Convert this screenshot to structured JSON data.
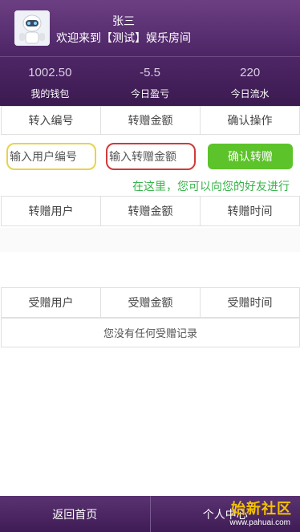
{
  "header": {
    "user_name": "张三",
    "welcome": "欢迎来到【测试】娱乐房间"
  },
  "stats": [
    {
      "value": "1002.50",
      "label": "我的钱包"
    },
    {
      "value": "-5.5",
      "label": "今日盈亏"
    },
    {
      "value": "220",
      "label": "今日流水"
    }
  ],
  "transfer": {
    "col1": "转入编号",
    "col2": "转赠金额",
    "col3": "确认操作",
    "user_placeholder": "输入用户编号",
    "amount_placeholder": "输入转赠金额",
    "confirm_label": "确认转赠"
  },
  "notice": "在这里，您可以向您的好友进行",
  "sent_table": {
    "col1": "转赠用户",
    "col2": "转赠金额",
    "col3": "转赠时间"
  },
  "received_table": {
    "col1": "受赠用户",
    "col2": "受赠金额",
    "col3": "受赠时间",
    "empty": "您没有任何受赠记录"
  },
  "footer": {
    "home": "返回首页",
    "center": "个人中心"
  },
  "watermark": {
    "title": "始新社区",
    "url": "www.pahuai.com"
  },
  "colors": {
    "header_bg": "#5a2f74",
    "confirm_btn": "#5cc32a",
    "notice_text": "#38b34a"
  }
}
